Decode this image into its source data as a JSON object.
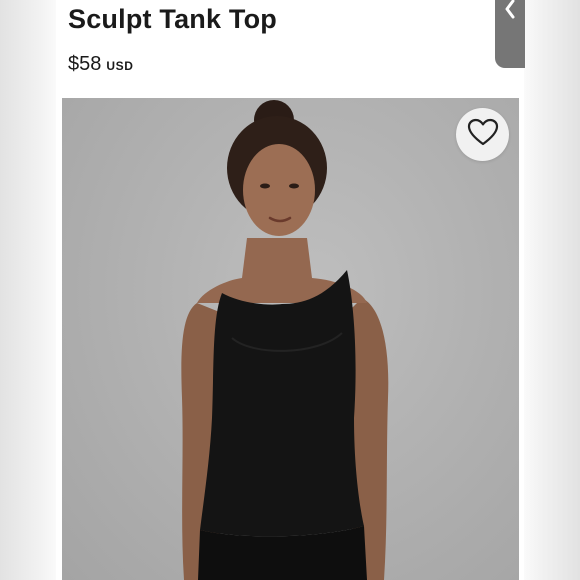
{
  "product": {
    "title": "Sculpt Tank Top",
    "price": "$58",
    "currency": "USD"
  },
  "icons": {
    "back": "chevron-left-icon",
    "favorite": "heart-outline-icon"
  },
  "colors": {
    "text": "#1a1a1a",
    "back_tab": "#767676",
    "photo_background": "#b4b4b4",
    "garment": "#141414"
  }
}
